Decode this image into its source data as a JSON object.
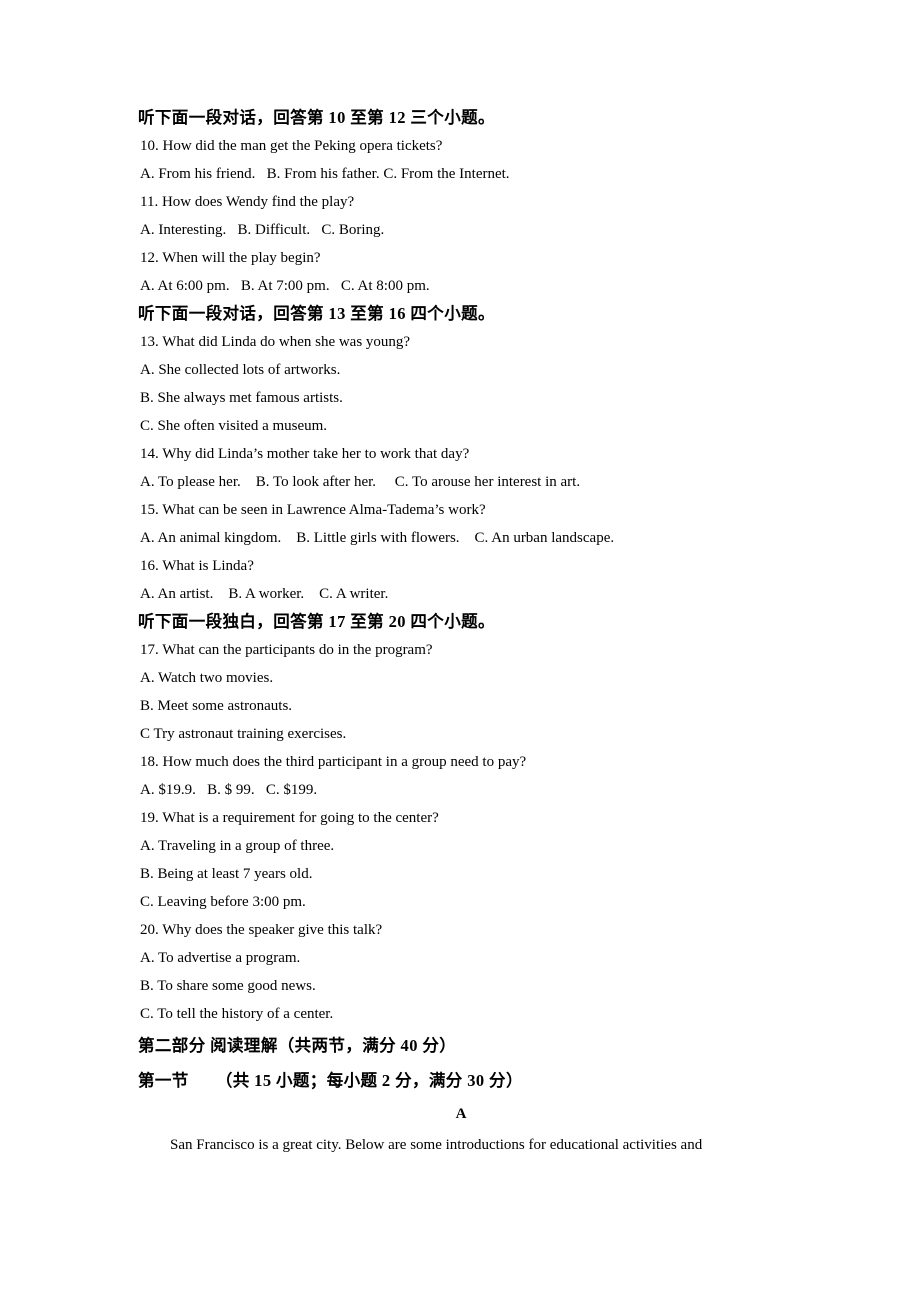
{
  "document": {
    "type": "exam-paper",
    "language": "zh-CN + en",
    "background_color": "#ffffff",
    "text_color": "#000000"
  },
  "blocks": [
    {
      "kind": "cjk-heading",
      "name": "listening-section-heading-10-12",
      "text": "听下面一段对话，回答第 10 至第 12 三个小题。"
    },
    {
      "kind": "question",
      "name": "question-10-stem",
      "text": "10. How did the man get the Peking opera tickets?"
    },
    {
      "kind": "options",
      "name": "question-10-options",
      "text": "A. From his friend.   B. From his father. C. From the Internet."
    },
    {
      "kind": "question",
      "name": "question-11-stem",
      "text": "11. How does Wendy find the play?"
    },
    {
      "kind": "options",
      "name": "question-11-options",
      "text": "A. Interesting.   B. Difficult.   C. Boring."
    },
    {
      "kind": "question",
      "name": "question-12-stem",
      "text": "12. When will the play begin?"
    },
    {
      "kind": "options",
      "name": "question-12-options",
      "text": "A. At 6:00 pm.   B. At 7:00 pm.   C. At 8:00 pm."
    },
    {
      "kind": "cjk-heading",
      "name": "listening-section-heading-13-16",
      "text": "听下面一段对话，回答第 13 至第 16 四个小题。"
    },
    {
      "kind": "question",
      "name": "question-13-stem",
      "text": "13. What did Linda do when she was young?"
    },
    {
      "kind": "options",
      "name": "question-13-option-a",
      "text": "A. She collected lots of artworks."
    },
    {
      "kind": "options",
      "name": "question-13-option-b",
      "text": "B. She always met famous artists."
    },
    {
      "kind": "options",
      "name": "question-13-option-c",
      "text": "C. She often visited a museum."
    },
    {
      "kind": "question",
      "name": "question-14-stem",
      "text": "14. Why did Linda’s mother take her to work that day?"
    },
    {
      "kind": "options",
      "name": "question-14-options",
      "text": "A. To please her.    B. To look after her.     C. To arouse her interest in art."
    },
    {
      "kind": "question",
      "name": "question-15-stem",
      "text": "15. What can be seen in Lawrence Alma-Tadema’s work?"
    },
    {
      "kind": "options",
      "name": "question-15-options",
      "text": "A. An animal kingdom.    B. Little girls with flowers.    C. An urban landscape."
    },
    {
      "kind": "question",
      "name": "question-16-stem",
      "text": "16. What is Linda?"
    },
    {
      "kind": "options",
      "name": "question-16-options",
      "text": "A. An artist.    B. A worker.    C. A writer."
    },
    {
      "kind": "cjk-heading",
      "name": "listening-section-heading-17-20",
      "text": "听下面一段独白，回答第 17 至第 20 四个小题。"
    },
    {
      "kind": "question",
      "name": "question-17-stem",
      "text": "17. What can the participants do in the program?"
    },
    {
      "kind": "options",
      "name": "question-17-option-a",
      "text": "A. Watch two movies."
    },
    {
      "kind": "options",
      "name": "question-17-option-b",
      "text": "B. Meet some astronauts."
    },
    {
      "kind": "options",
      "name": "question-17-option-c",
      "text": "C Try astronaut training exercises."
    },
    {
      "kind": "question",
      "name": "question-18-stem",
      "text": "18. How much does the third participant in a group need to pay?"
    },
    {
      "kind": "options",
      "name": "question-18-options",
      "text": "A. $19.9.   B. $ 99.   C. $199."
    },
    {
      "kind": "question",
      "name": "question-19-stem",
      "text": "19. What is a requirement for going to the center?"
    },
    {
      "kind": "options",
      "name": "question-19-option-a",
      "text": "A. Traveling in a group of three."
    },
    {
      "kind": "options",
      "name": "question-19-option-b",
      "text": "B. Being at least 7 years old."
    },
    {
      "kind": "options",
      "name": "question-19-option-c",
      "text": "C. Leaving before 3:00 pm."
    },
    {
      "kind": "question",
      "name": "question-20-stem",
      "text": "20. Why does the speaker give this talk?"
    },
    {
      "kind": "options",
      "name": "question-20-option-a",
      "text": "A. To advertise a program."
    },
    {
      "kind": "options",
      "name": "question-20-option-b",
      "text": "B. To share some good news."
    },
    {
      "kind": "options",
      "name": "question-20-option-c",
      "text": "C. To tell the history of a center."
    },
    {
      "kind": "part-heading",
      "name": "part-two-heading",
      "text": "第二部分 阅读理解（共两节，满分 40 分）"
    },
    {
      "kind": "part-heading",
      "name": "section-one-heading",
      "text": "第一节      （共 15 小题；每小题 2 分，满分 30 分）"
    },
    {
      "kind": "passage-label",
      "name": "passage-label-a",
      "text": "A"
    },
    {
      "kind": "passage",
      "name": "passage-a-body",
      "text": "San Francisco is a great city. Below are some introductions for educational activities and"
    }
  ]
}
